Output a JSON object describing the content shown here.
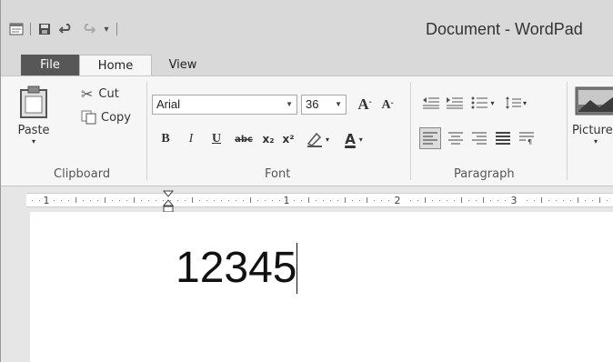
{
  "window": {
    "title": "Document - WordPad"
  },
  "quick_access": {
    "icons": [
      "wordpad-app-icon",
      "save-icon",
      "undo-icon",
      "redo-icon",
      "customize-dropdown-icon"
    ]
  },
  "tabs": [
    {
      "label": "File"
    },
    {
      "label": "Home"
    },
    {
      "label": "View"
    }
  ],
  "ribbon": {
    "clipboard": {
      "paste": "Paste",
      "cut": "Cut",
      "copy": "Copy",
      "group": "Clipboard"
    },
    "font": {
      "family": "Arial",
      "size": "36",
      "group": "Font",
      "bold": "B",
      "italic": "I",
      "underline": "U",
      "strike": "abc",
      "subscript": "x₂",
      "superscript": "x²",
      "grow": "A",
      "shrink": "A",
      "color": "A"
    },
    "paragraph": {
      "group": "Paragraph"
    },
    "insert": {
      "picture": "Picture"
    }
  },
  "ruler": {
    "numbers": [
      "1",
      "1",
      "2",
      "3"
    ]
  },
  "document": {
    "text": "12345"
  }
}
